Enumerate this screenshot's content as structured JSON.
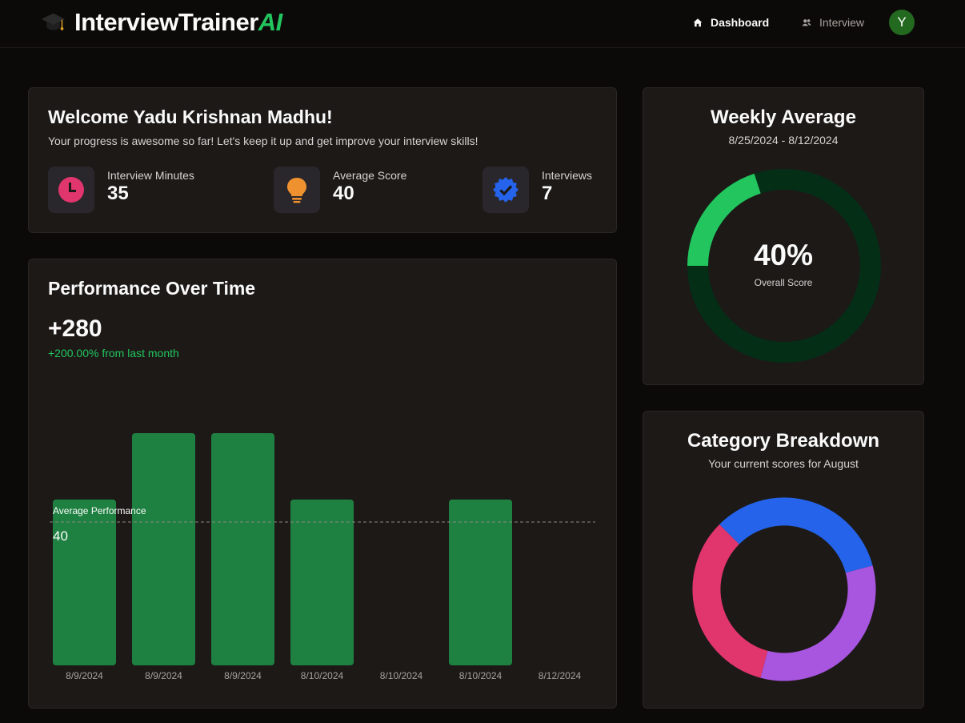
{
  "brand": {
    "name": "InterviewTrainer",
    "accent": "AI",
    "accent_color": "#22c55e"
  },
  "nav": {
    "dashboard_label": "Dashboard",
    "interview_label": "Interview",
    "avatar_initial": "Y",
    "avatar_color": "#23691f"
  },
  "welcome": {
    "title": "Welcome Yadu Krishnan Madhu!",
    "subtitle": "Your progress is awesome so far! Let's keep it up and get improve your interview skills!",
    "stats": [
      {
        "label": "Interview Minutes",
        "value": "35",
        "icon": "clock-icon",
        "color": "#e0356d"
      },
      {
        "label": "Average Score",
        "value": "40",
        "icon": "lightbulb-icon",
        "color": "#f0912f"
      },
      {
        "label": "Interviews",
        "value": "7",
        "icon": "verified-badge-icon",
        "color": "#2563eb"
      }
    ]
  },
  "performance": {
    "title": "Performance Over Time",
    "total": "+280",
    "change": "+200.00% from last month",
    "average_label": "Average Performance",
    "average_value": "40"
  },
  "weekly": {
    "title": "Weekly Average",
    "date_range": "8/25/2024 - 8/12/2024",
    "score_text": "40%",
    "score_label": "Overall Score",
    "score_fraction": 0.4,
    "fill_color": "#22c55e",
    "track_color": "#052e16"
  },
  "category": {
    "title": "Category Breakdown",
    "subtitle": "Your current scores for August"
  },
  "chart_data": [
    {
      "type": "bar",
      "categories": [
        "8/9/2024",
        "8/9/2024",
        "8/9/2024",
        "8/10/2024",
        "8/10/2024",
        "8/10/2024",
        "8/12/2024"
      ],
      "values": [
        50,
        70,
        70,
        50,
        0,
        50,
        0
      ],
      "reference_line": {
        "label": "Average Performance",
        "value": 40
      },
      "ylim": [
        0,
        70
      ],
      "color": "#1f8141",
      "grid": false
    },
    {
      "type": "pie",
      "slices": [
        {
          "value": 33.3,
          "color": "#2563eb"
        },
        {
          "value": 33.3,
          "color": "#a855df"
        },
        {
          "value": 33.3,
          "color": "#e0356d"
        }
      ]
    }
  ]
}
